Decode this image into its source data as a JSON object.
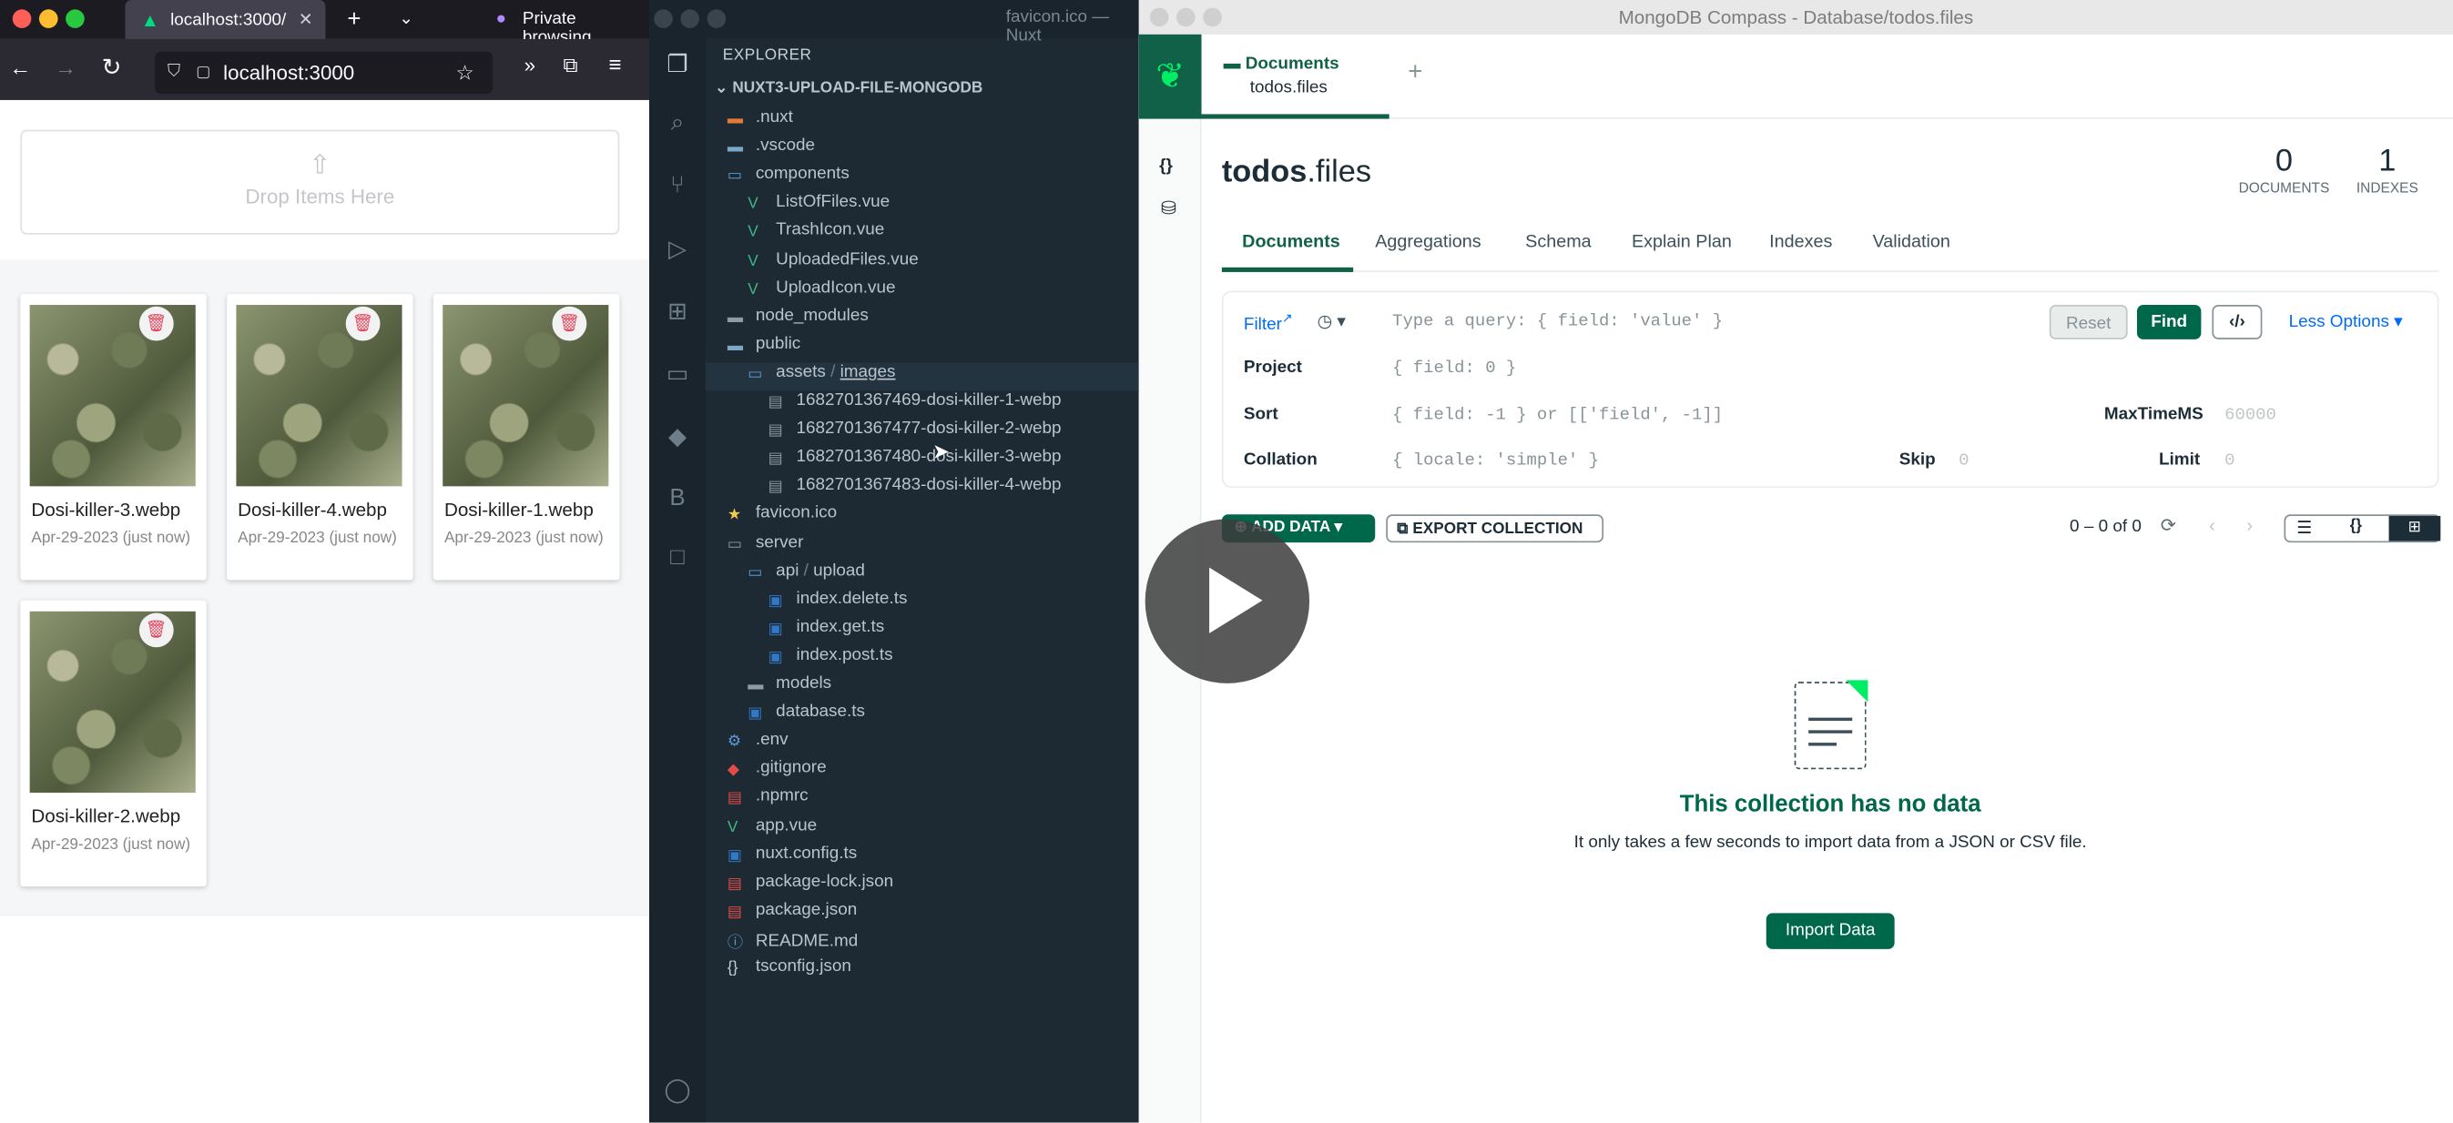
{
  "browser": {
    "tab_title": "localhost:3000/",
    "private": "Private browsing",
    "url": "localhost:3000",
    "dropzone": "Drop Items Here",
    "files": [
      {
        "name": "Dosi-killer-3.webp",
        "date": "Apr-29-2023 (just now)"
      },
      {
        "name": "Dosi-killer-4.webp",
        "date": "Apr-29-2023 (just now)"
      },
      {
        "name": "Dosi-killer-1.webp",
        "date": "Apr-29-2023 (just now)"
      },
      {
        "name": "Dosi-killer-2.webp",
        "date": "Apr-29-2023 (just now)"
      }
    ]
  },
  "vscode": {
    "title": "favicon.ico — Nuxt",
    "explorer": "EXPLORER",
    "project": "NUXT3-UPLOAD-FILE-MONGODB",
    "tree": [
      ".nuxt",
      ".vscode",
      "components",
      "ListOfFiles.vue",
      "TrashIcon.vue",
      "UploadedFiles.vue",
      "UploadIcon.vue",
      "node_modules",
      "public",
      "assets",
      "images",
      "1682701367469-dosi-killer-1-webp",
      "1682701367477-dosi-killer-2-webp",
      "1682701367480-dosi-killer-3-webp",
      "1682701367483-dosi-killer-4-webp",
      "favicon.ico",
      "server",
      "api",
      "upload",
      "index.delete.ts",
      "index.get.ts",
      "index.post.ts",
      "models",
      "database.ts",
      ".env",
      ".gitignore",
      ".npmrc",
      "app.vue",
      "nuxt.config.ts",
      "package-lock.json",
      "package.json",
      "README.md",
      "tsconfig.json"
    ]
  },
  "compass": {
    "window_title": "MongoDB Compass - Database/todos.files",
    "tab_label": "Documents",
    "tab_sub": "todos.files",
    "plus": "+",
    "db": "todos",
    "coll": ".files",
    "doc_count": "0",
    "doc_label": "DOCUMENTS",
    "idx_count": "1",
    "idx_label": "INDEXES",
    "tabs": [
      "Documents",
      "Aggregations",
      "Schema",
      "Explain Plan",
      "Indexes",
      "Validation"
    ],
    "filter": "Filter",
    "filter_ph": "Type a query: { field: 'value' }",
    "reset": "Reset",
    "find": "Find",
    "less": "Less Options",
    "project": "Project",
    "project_ph": "{ field: 0 }",
    "sort": "Sort",
    "sort_ph": "{ field: -1 } or [['field', -1]]",
    "maxtime": "MaxTimeMS",
    "maxtime_ph": "60000",
    "collation": "Collation",
    "collation_ph": "{ locale: 'simple' }",
    "skip": "Skip",
    "skip_ph": "0",
    "limit": "Limit",
    "limit_ph": "0",
    "add_data": "ADD DATA",
    "export": "EXPORT COLLECTION",
    "range": "0 – 0 of 0",
    "empty_title": "This collection has no data",
    "empty_text": "It only takes a few seconds to import data from a JSON or CSV file.",
    "import": "Import Data"
  },
  "colors": {
    "accent": "#116149",
    "leaf": "#00ed64"
  }
}
